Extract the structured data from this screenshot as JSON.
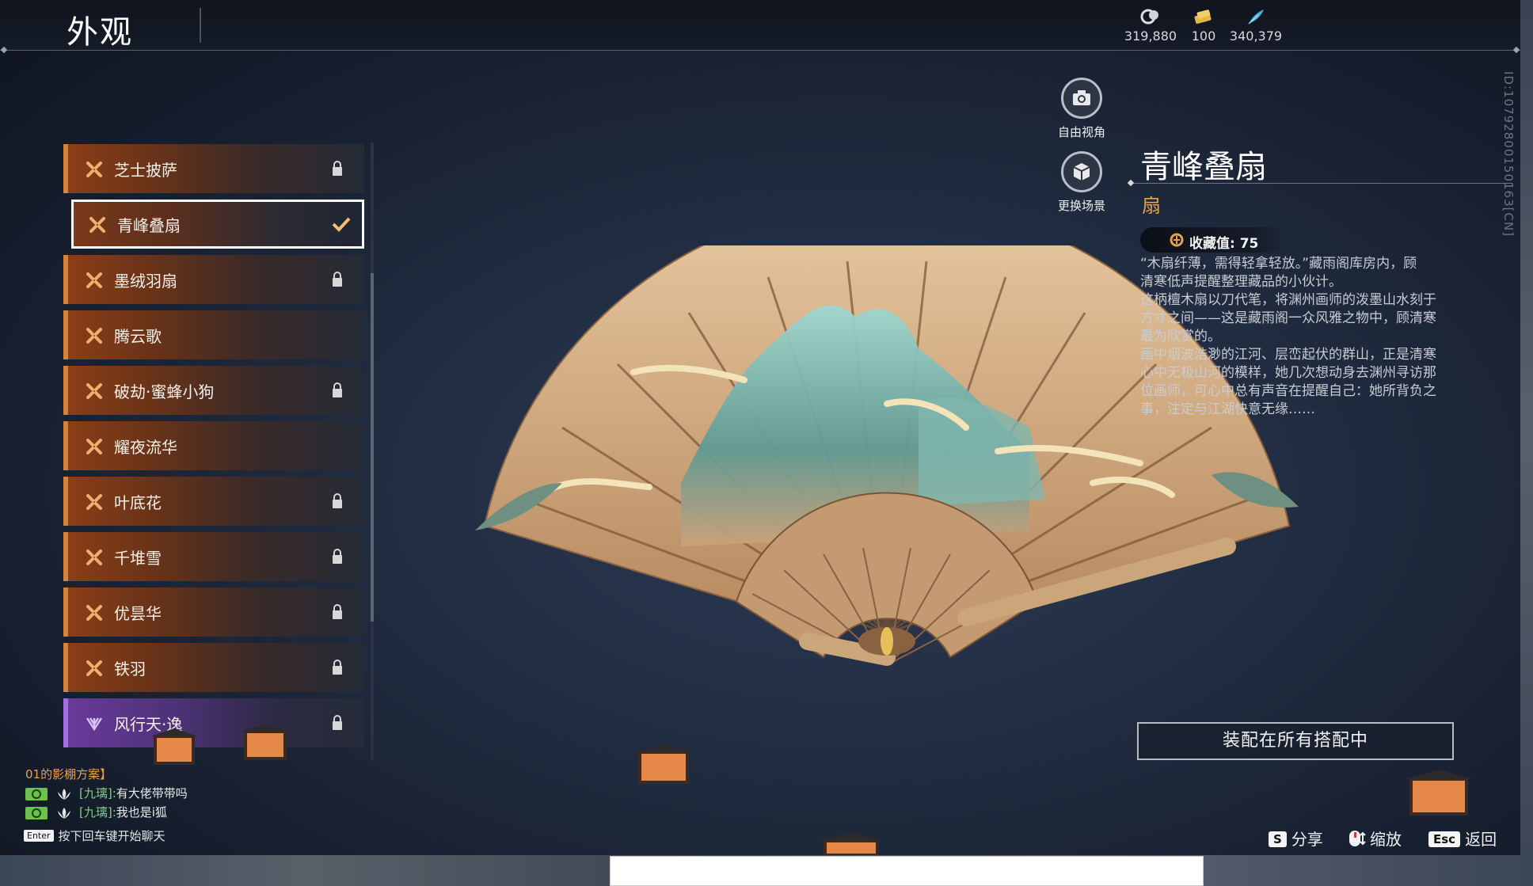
{
  "header": {
    "title": "外观",
    "currencies": [
      {
        "icon": "coin-icon",
        "value": "319,880"
      },
      {
        "icon": "ticket-icon",
        "value": "100"
      },
      {
        "icon": "feather-icon",
        "value": "340,379"
      }
    ],
    "id_text": "ID:10792800150163[CN]"
  },
  "list": {
    "items": [
      {
        "label": "芝士披萨",
        "state": "locked"
      },
      {
        "label": "青峰叠扇",
        "state": "selected"
      },
      {
        "label": "墨绒羽扇",
        "state": "locked"
      },
      {
        "label": "腾云歌",
        "state": "none"
      },
      {
        "label": "破劫·蜜蜂小狗",
        "state": "locked"
      },
      {
        "label": "耀夜流华",
        "state": "none"
      },
      {
        "label": "叶底花",
        "state": "locked"
      },
      {
        "label": "千堆雪",
        "state": "locked"
      },
      {
        "label": "优昙华",
        "state": "locked"
      },
      {
        "label": "铁羽",
        "state": "locked"
      },
      {
        "label": "风行天·逸",
        "state": "locked"
      }
    ]
  },
  "camera": {
    "free_view": "自由视角",
    "change_scene": "更换场景"
  },
  "detail": {
    "name": "青峰叠扇",
    "type": "扇",
    "collect_value": "收藏值: 75",
    "desc_lines": [
      "“木扇纤薄，需得轻拿轻放。”藏雨阁库房内，顾",
      "清寒低声提醒整理藏品的小伙计。",
      "这柄檀木扇以刀代笔，将渊州画师的泼墨山水刻于",
      "方寸之间——这是藏雨阁一众风雅之物中，顾清寒",
      "最为欣赏的。",
      "画中烟波浩渺的江河、层峦起伏的群山，正是清寒",
      "心中无极山河的模样，她几次想动身去渊州寻访那",
      "位画师，可心中总有声音在提醒自己：她所背负之",
      "事，注定与江湖快意无缘……"
    ],
    "equip_button": "装配在所有搭配中"
  },
  "chat": {
    "scheme": "01的影棚方案】",
    "lines": [
      {
        "channel": "[九璃]:",
        "text": "有大佬带带吗"
      },
      {
        "channel": "[九璃]:",
        "text": "我也是i狐"
      }
    ],
    "hint_key": "Enter",
    "hint": "按下回车键开始聊天"
  },
  "keys": {
    "share_key": "S",
    "share": "分享",
    "zoom": "缩放",
    "back_key": "Esc",
    "back": "返回"
  },
  "colors": {
    "accent_orange": "#d8823a",
    "type_gold": "#e6a24a",
    "purple_rarity": "#a070e0"
  }
}
